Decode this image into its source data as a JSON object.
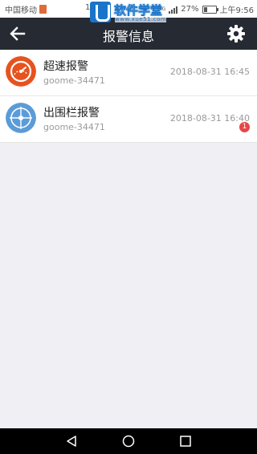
{
  "status_bar": {
    "carrier": "中国移动",
    "carrier_fragment": "1",
    "network": "4G",
    "battery": "27%",
    "time": "上午9:56"
  },
  "watermark": {
    "title": "软件学堂",
    "url": "www.xue51.com"
  },
  "header": {
    "title": "报警信息",
    "back_icon": "arrow-left-icon",
    "settings_icon": "gear-icon"
  },
  "alarms": [
    {
      "name": "超速报警",
      "device": "goome-34471",
      "time": "2018-08-31 16:45",
      "icon": "speedometer-icon",
      "icon_color": "#e6531f",
      "badge": ""
    },
    {
      "name": "出围栏报警",
      "device": "goome-34471",
      "time": "2018-08-31 16:40",
      "icon": "fence-target-icon",
      "icon_color": "#5b9bd8",
      "badge": "1"
    }
  ],
  "nav_bar": {
    "back_icon": "triangle-back-icon",
    "home_icon": "circle-home-icon",
    "recents_icon": "square-recents-icon"
  },
  "colors": {
    "header_bg": "#262a33",
    "page_bg": "#efeff4",
    "badge": "#e84545"
  }
}
